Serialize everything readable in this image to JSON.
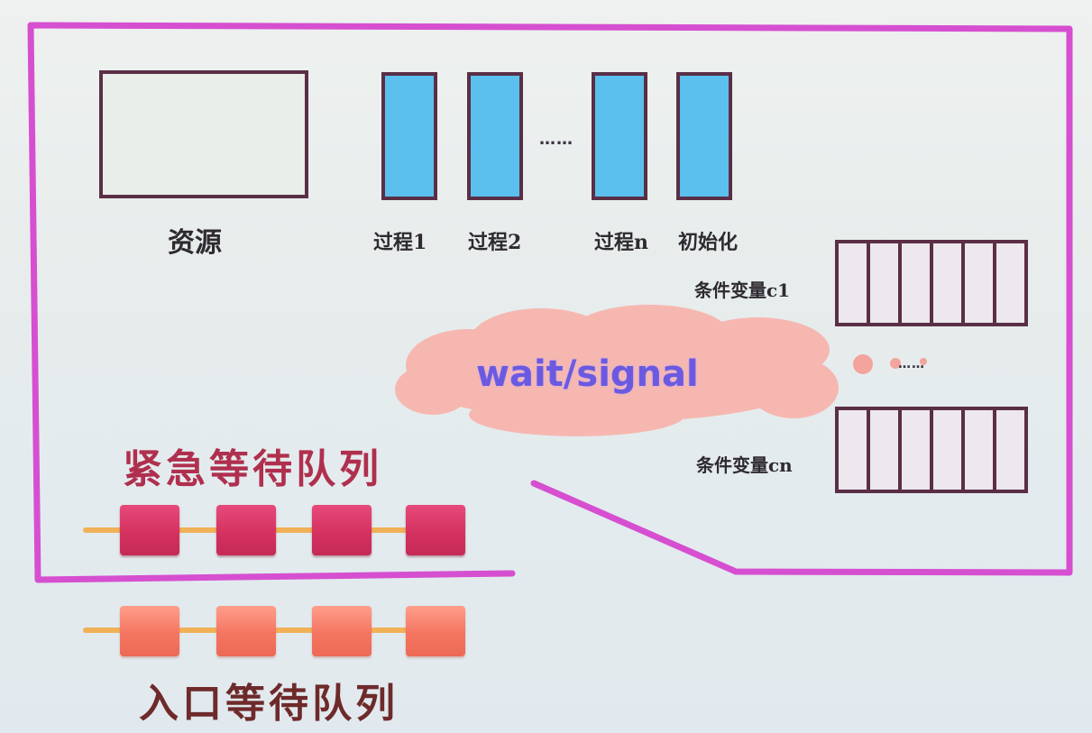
{
  "diagram": {
    "resource_label": "资源",
    "procedures": [
      {
        "label": "过程1"
      },
      {
        "label": "过程2"
      },
      {
        "label": "过程n"
      },
      {
        "label": "初始化"
      }
    ],
    "ellipsis": "……",
    "condition_vars": [
      {
        "label": "条件变量c1"
      },
      {
        "label": "条件变量cn"
      }
    ],
    "cv_ellipsis": "……",
    "cloud_label": "wait/signal",
    "urgent_queue_label": "紧急等待队列",
    "entry_queue_label": "入口等待队列",
    "colors": {
      "monitor_border": "#d64fd0",
      "procedure_fill": "#5bc0ee",
      "cloud_fill": "#f7b7b1",
      "urgent_block": "#d4305f",
      "entry_block": "#f47560"
    }
  }
}
